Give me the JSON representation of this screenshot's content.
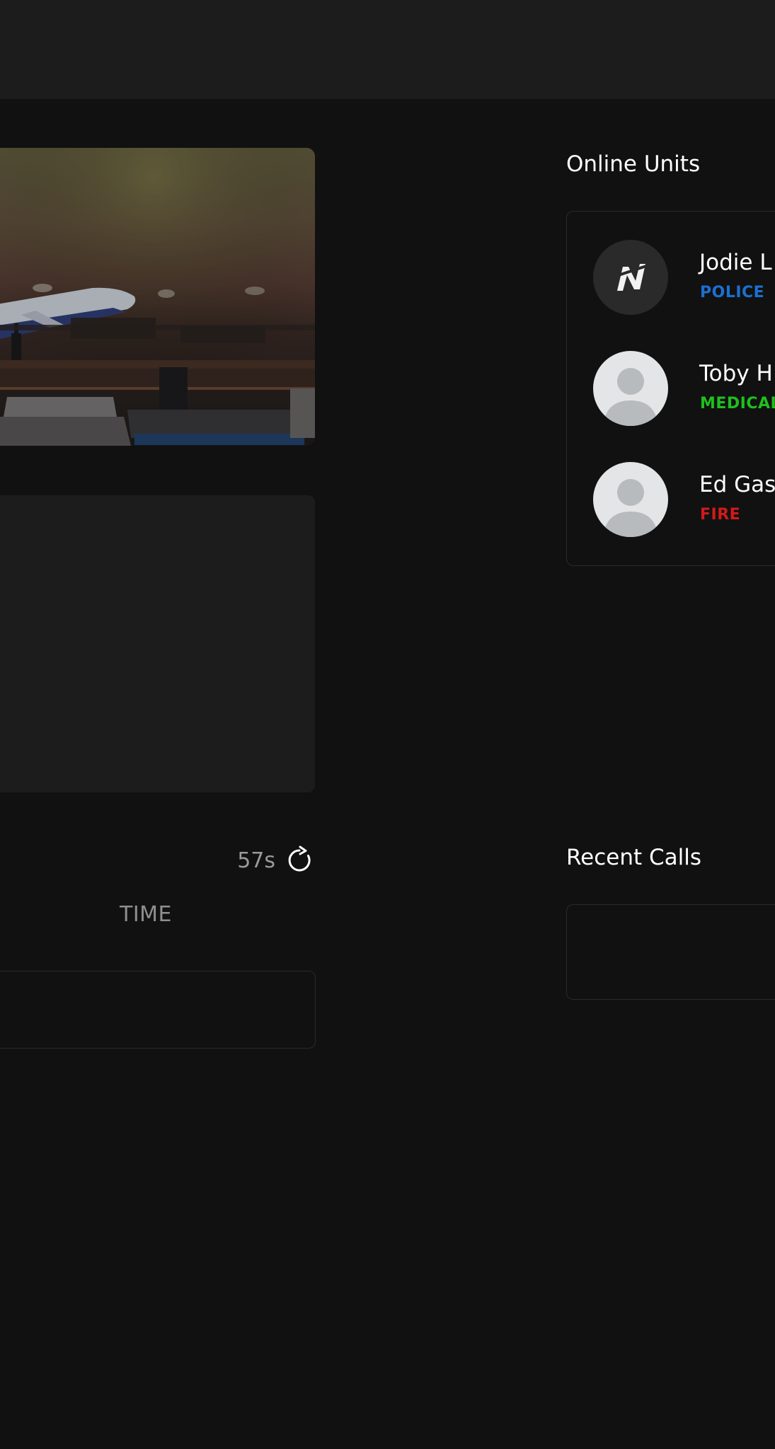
{
  "colors": {
    "background": "#111111",
    "topbar": "#1c1c1c",
    "police": "#1d6fd1",
    "medical": "#1ec01e",
    "fire": "#d11a1a"
  },
  "call_feed": {
    "refresh_timer": "57s",
    "refresh_icon": "refresh-icon",
    "columns": [
      "TIME"
    ]
  },
  "online_units": {
    "title": "Online Units",
    "units": [
      {
        "name": "Jodie L",
        "department": "POLICE",
        "dept_color": "#1d6fd1",
        "avatar": "brand-logo-icon"
      },
      {
        "name": "Toby H",
        "department": "MEDICAL",
        "dept_color": "#1ec01e",
        "avatar": "default-avatar-icon"
      },
      {
        "name": "Ed Gas",
        "department": "FIRE",
        "dept_color": "#d11a1a",
        "avatar": "default-avatar-icon"
      }
    ]
  },
  "recent_calls": {
    "title": "Recent Calls"
  }
}
